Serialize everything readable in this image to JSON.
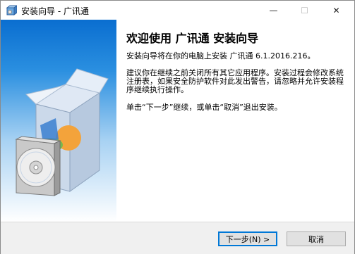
{
  "window": {
    "title": "安装向导 - 广讯通",
    "controls": {
      "minimize": "—",
      "maximize": "☐",
      "close": "✕"
    }
  },
  "content": {
    "heading": "欢迎使用 广讯通 安装向导",
    "paragraph1": "安装向导将在你的电脑上安装 广讯通 6.1.2016.216。",
    "paragraph2": "建议你在继续之前关闭所有其它应用程序。安装过程会修改系统注册表，如果安全防护软件对此发出警告，请忽略并允许安装程序继续执行操作。",
    "paragraph3": "单击“下一步”继续，或单击“取消”退出安装。"
  },
  "buttons": {
    "next": "下一步(N) >",
    "cancel": "取消"
  },
  "icons": {
    "app": "installer-box-icon",
    "illustration": "software-box-cd-icon"
  },
  "colors": {
    "panel_top": "#0a6ed0",
    "panel_bottom": "#ffffff",
    "focus": "#0078d7"
  }
}
